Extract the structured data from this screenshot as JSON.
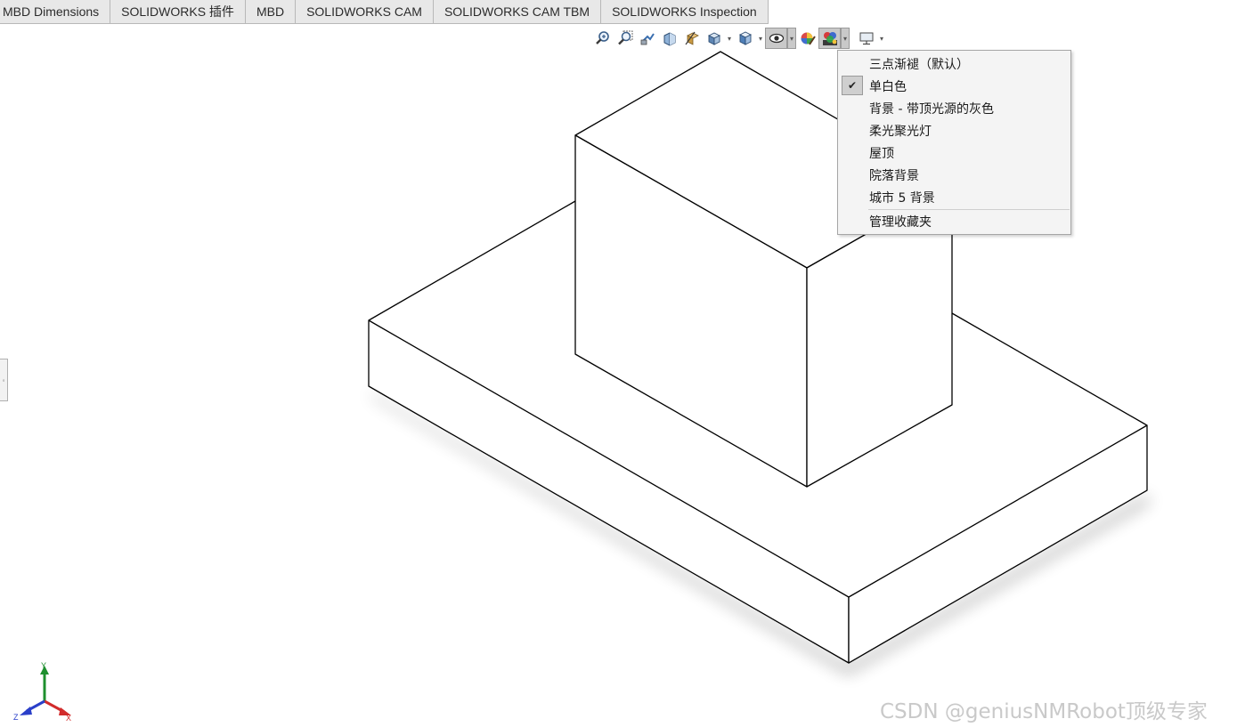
{
  "tabs": [
    "MBD Dimensions",
    "SOLIDWORKS 插件",
    "MBD",
    "SOLIDWORKS CAM",
    "SOLIDWORKS CAM TBM",
    "SOLIDWORKS Inspection"
  ],
  "heads_up_toolbar": {
    "icons": [
      "zoom-to-fit-icon",
      "zoom-to-area-icon",
      "previous-view-icon",
      "section-view-icon",
      "dynamic-annotation-views-icon",
      "view-orientation-icon",
      "display-style-icon",
      "hide-show-items-icon",
      "edit-appearance-icon",
      "apply-scene-icon",
      "view-settings-icon"
    ],
    "active": "apply-scene-icon"
  },
  "scene_menu": {
    "items": [
      {
        "label": "三点渐褪（默认）",
        "checked": false
      },
      {
        "label": "单白色",
        "checked": true
      },
      {
        "label": "背景 - 带顶光源的灰色",
        "checked": false
      },
      {
        "label": "柔光聚光灯",
        "checked": false
      },
      {
        "label": "屋顶",
        "checked": false
      },
      {
        "label": "院落背景",
        "checked": false
      },
      {
        "label": "城市 5 背景",
        "checked": false
      }
    ],
    "manage_label": "管理收藏夹"
  },
  "triad": {
    "x": "X",
    "y": "Y",
    "z": "Z"
  },
  "watermark": "CSDN @geniusNMRobot顶级专家",
  "colors": {
    "tab_bg": "#e8e8e8",
    "menu_bg": "#f4f4f4",
    "triad_x": "#d22b2b",
    "triad_y": "#1e8f2e",
    "triad_z": "#2a3fc9"
  }
}
